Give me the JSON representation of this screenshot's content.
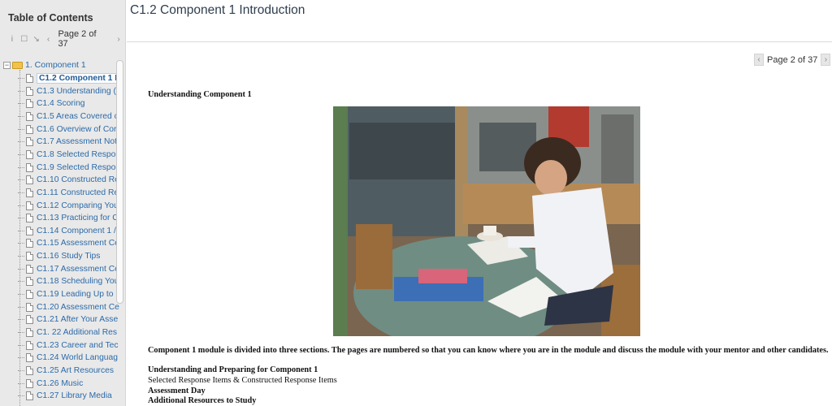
{
  "sidebar": {
    "title": "Table of Contents",
    "page_indicator": "Page 2 of 37",
    "root": "1. Component 1",
    "items": [
      "C1.2 Component 1 I",
      "C1.3 Understanding (",
      "C1.4 Scoring",
      "C1.5 Areas Covered c",
      "C1.6 Overview of Cor",
      "C1.7 Assessment Not",
      "C1.8 Selected Respor",
      "C1.9 Selected Respor",
      "C1.10 Constructed Re",
      "C1.11 Constructed Re",
      "C1.12 Comparing You",
      "C1.13 Practicing for C",
      "C1.14 Component 1 /",
      "C1.15 Assessment Ce",
      "C1.16 Study Tips",
      "C1.17 Assessment Ce",
      "C1.18 Scheduling You",
      "C1.19 Leading Up to",
      "C1.20 Assessment Ce",
      "C1.21 After Your Asse",
      "C1. 22 Additional Res",
      "C1.23 Career and Tec",
      "C1.24 World Languag",
      "C1.25 Art Resources",
      "C1.26 Music",
      "C1.27 Library Media"
    ]
  },
  "main": {
    "title": "C1.2 Component 1 Introduction",
    "page_indicator": "Page 2 of 37",
    "heading": "Understanding Component 1",
    "intro": "Component 1 module is divided into three sections. The pages are numbered so that you can know where you are in the module and discuss the module with your mentor and other candidates.",
    "section1": "Understanding and Preparing for Component 1",
    "section1_sub": "Selected Response Items & Constructed Response Items",
    "section2": "Assessment Day",
    "section3": "Additional Resources to Study"
  },
  "colors": {
    "link": "#2b6aa9",
    "sidebar_bg": "#e9e9e9",
    "title": "#2e3e4e"
  }
}
